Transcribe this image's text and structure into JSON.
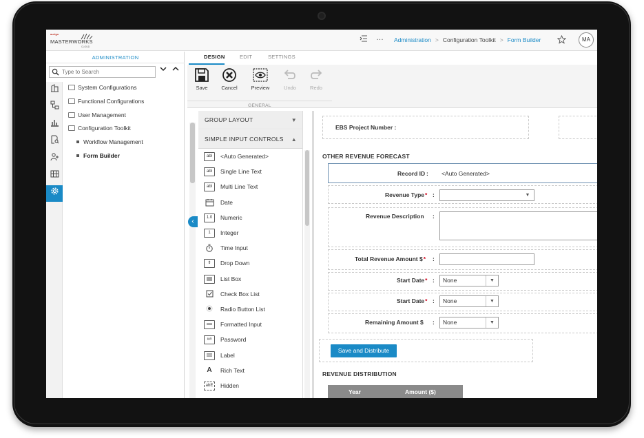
{
  "app": {
    "logo_small": "aurigo",
    "logo_name": "MASTERWORKS",
    "logo_sub": "CLOUD",
    "user_initials": "MA"
  },
  "breadcrumb": {
    "items": [
      "Administration",
      "Configuration Toolkit",
      "Form Builder"
    ]
  },
  "left_panel": {
    "title": "ADMINISTRATION",
    "search_placeholder": "Type to Search",
    "tree": [
      "System Configurations",
      "Functional Configurations",
      "User Management",
      "Configuration Toolkit",
      "Workflow Management",
      "Form Builder"
    ]
  },
  "tabs": [
    "DESIGN",
    "EDIT",
    "SETTINGS"
  ],
  "toolbar": {
    "buttons": [
      "Save",
      "Cancel",
      "Preview",
      "Undo",
      "Redo"
    ],
    "group_label": "GENERAL"
  },
  "controls": {
    "group_layout": "GROUP LAYOUT",
    "simple_input": "SIMPLE INPUT CONTROLS",
    "items": [
      {
        "label": "<Auto Generated>",
        "icon": "abl"
      },
      {
        "label": "Single Line Text",
        "icon": "abl"
      },
      {
        "label": "Multi Line Text",
        "icon": "abl"
      },
      {
        "label": "Date",
        "icon": "calendar"
      },
      {
        "label": "Numeric",
        "icon": "1.0"
      },
      {
        "label": "Integer",
        "icon": "1"
      },
      {
        "label": "Time Input",
        "icon": "stopwatch"
      },
      {
        "label": "Drop Down",
        "icon": "dropdown"
      },
      {
        "label": "List Box",
        "icon": "listbox"
      },
      {
        "label": "Check Box List",
        "icon": "checkbox"
      },
      {
        "label": "Radio Button List",
        "icon": "radio"
      },
      {
        "label": "Formatted Input",
        "icon": "formatted"
      },
      {
        "label": "Password",
        "icon": "##"
      },
      {
        "label": "Label",
        "icon": "label"
      },
      {
        "label": "Rich Text",
        "icon": "A"
      },
      {
        "label": "Hidden",
        "icon": "abE"
      }
    ]
  },
  "form": {
    "ebs_label": "EBS Project Number :",
    "section_other": "OTHER REVENUE FORECAST",
    "record_id_label": "Record ID",
    "record_id_value": "<Auto Generated>",
    "revenue_type_label": "Revenue Type",
    "revenue_desc_label": "Revenue Description",
    "total_amount_label": "Total Revenue Amount $",
    "start_date_label": "Start Date",
    "start_date_value": "None",
    "start_date2_label": "Start Date",
    "start_date2_value": "None",
    "remaining_label": "Remaining Amount $",
    "remaining_value": "None",
    "colon": ":",
    "required_mark": "*",
    "save_distribute": "Save and Distribute",
    "section_distribution": "REVENUE DISTRIBUTION",
    "grid_cols": [
      "Year",
      "Amount ($)"
    ]
  },
  "colors": {
    "accent": "#1a8ac6",
    "required": "#d0021b"
  }
}
